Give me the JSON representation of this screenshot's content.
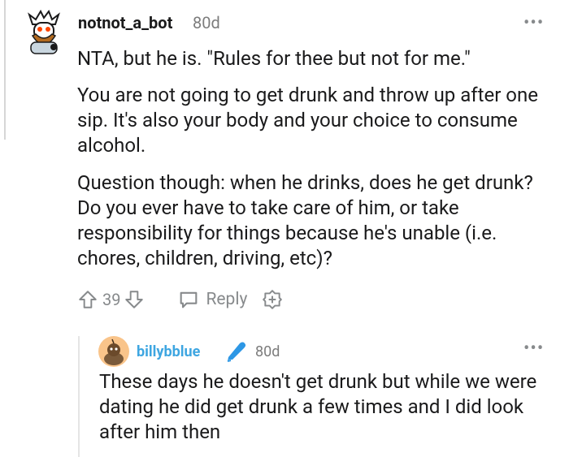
{
  "comment": {
    "username": "notnot_a_bot",
    "time": "80d",
    "more": "•••",
    "paragraphs": [
      "NTA, but he is. \"Rules for thee but not for me.\"",
      "You are not going to get drunk and throw up after one sip. It's also your body and your choice to consume alcohol.",
      "Question though: when he drinks, does he get drunk? Do you ever have to take care of him, or take responsibility for things because he's unable (i.e. chores, children, driving, etc)?"
    ],
    "actions": {
      "vote_count": "39",
      "reply_label": "Reply"
    }
  },
  "reply": {
    "username": "billybblue",
    "time": "80d",
    "more": "•••",
    "body": "These days he doesn't get drunk but while we were dating he did get drunk a few times and I did look after him then"
  },
  "colors": {
    "text": "#1a1a1b",
    "muted": "#878a8c",
    "reply_username": "#3ea6e1",
    "accent_orange": "#ff4500"
  },
  "icons": [
    "upvote-icon",
    "downvote-icon",
    "reply-icon",
    "award-icon",
    "pen-icon"
  ]
}
